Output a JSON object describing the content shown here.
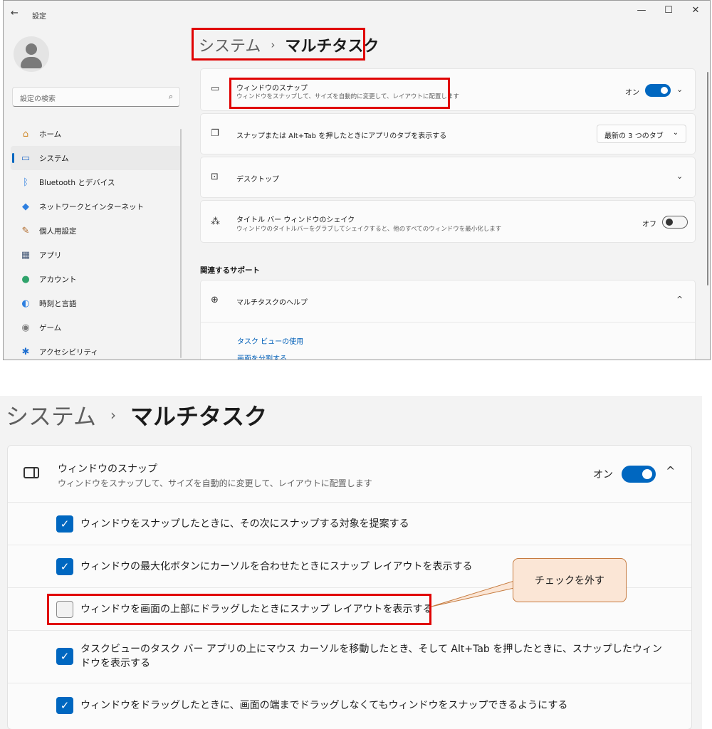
{
  "window": {
    "back_icon": "←",
    "title": "設定",
    "minimize_icon": "—",
    "maximize_icon": "☐",
    "close_icon": "✕"
  },
  "search": {
    "placeholder": "設定の検索",
    "icon": "⌕"
  },
  "sidebar": {
    "items": [
      {
        "label": "ホーム",
        "icon": "home-icon",
        "glyph": "⌂",
        "color": "#d08a2c"
      },
      {
        "label": "システム",
        "icon": "system-icon",
        "glyph": "▭",
        "color": "#2b6fc9",
        "active": true
      },
      {
        "label": "Bluetooth とデバイス",
        "icon": "bluetooth-icon",
        "glyph": "ᛒ",
        "color": "#2d7fe0"
      },
      {
        "label": "ネットワークとインターネット",
        "icon": "network-icon",
        "glyph": "◆",
        "color": "#2d7fe0"
      },
      {
        "label": "個人用設定",
        "icon": "brush-icon",
        "glyph": "✎",
        "color": "#b06a2a"
      },
      {
        "label": "アプリ",
        "icon": "apps-icon",
        "glyph": "▦",
        "color": "#4a5d7a"
      },
      {
        "label": "アカウント",
        "icon": "account-icon",
        "glyph": "●",
        "color": "#2fa36b"
      },
      {
        "label": "時刻と言語",
        "icon": "time-language-icon",
        "glyph": "◐",
        "color": "#2d7fe0"
      },
      {
        "label": "ゲーム",
        "icon": "game-icon",
        "glyph": "◉",
        "color": "#7a7a7a"
      },
      {
        "label": "アクセシビリティ",
        "icon": "accessibility-icon",
        "glyph": "✱",
        "color": "#1f6fd0"
      }
    ]
  },
  "breadcrumb": {
    "parent": "システム",
    "separator": "›",
    "current": "マルチタスク"
  },
  "cards": {
    "snap": {
      "title": "ウィンドウのスナップ",
      "subtitle": "ウィンドウをスナップして、サイズを自動的に変更して、レイアウトに配置します",
      "toggle_label": "オン",
      "toggle_on": true
    },
    "alt_tab": {
      "title": "スナップまたは Alt+Tab を押したときにアプリのタブを表示する",
      "dropdown_value": "最新の 3 つのタブ"
    },
    "desktop": {
      "title": "デスクトップ"
    },
    "shake": {
      "title": "タイトル バー ウィンドウのシェイク",
      "subtitle": "ウィンドウのタイトルバーをグラブしてシェイクすると、他のすべてのウィンドウを最小化します",
      "toggle_label": "オフ",
      "toggle_on": false
    }
  },
  "related": {
    "heading": "関連するサポート",
    "help_title": "マルチタスクのヘルプ",
    "links": [
      "タスク ビューの使用",
      "画面を分割する"
    ]
  },
  "zoom": {
    "breadcrumb": {
      "parent": "システム",
      "separator": "›",
      "current": "マルチタスク"
    },
    "header": {
      "title": "ウィンドウのスナップ",
      "subtitle": "ウィンドウをスナップして、サイズを自動的に変更して、レイアウトに配置します",
      "toggle_label": "オン",
      "expand_icon": "^"
    },
    "options": [
      {
        "text": "ウィンドウをスナップしたときに、その次にスナップする対象を提案する",
        "checked": true
      },
      {
        "text": "ウィンドウの最大化ボタンにカーソルを合わせたときにスナップ レイアウトを表示する",
        "checked": true
      },
      {
        "text": "ウィンドウを画面の上部にドラッグしたときにスナップ レイアウトを表示する",
        "checked": false
      },
      {
        "text": "タスクビューのタスク バー アプリの上にマウス カーソルを移動したとき、そして Alt+Tab を押したときに、スナップしたウィンドウを表示する",
        "checked": true
      },
      {
        "text": "ウィンドウをドラッグしたときに、画面の端までドラッグしなくてもウィンドウをスナップできるようにする",
        "checked": true
      }
    ]
  },
  "callout": {
    "text": "チェックを外す"
  },
  "colors": {
    "accent": "#0067c0",
    "highlight": "#e00000",
    "callout_fill": "#fbe6d6",
    "callout_border": "#c57a3e"
  }
}
